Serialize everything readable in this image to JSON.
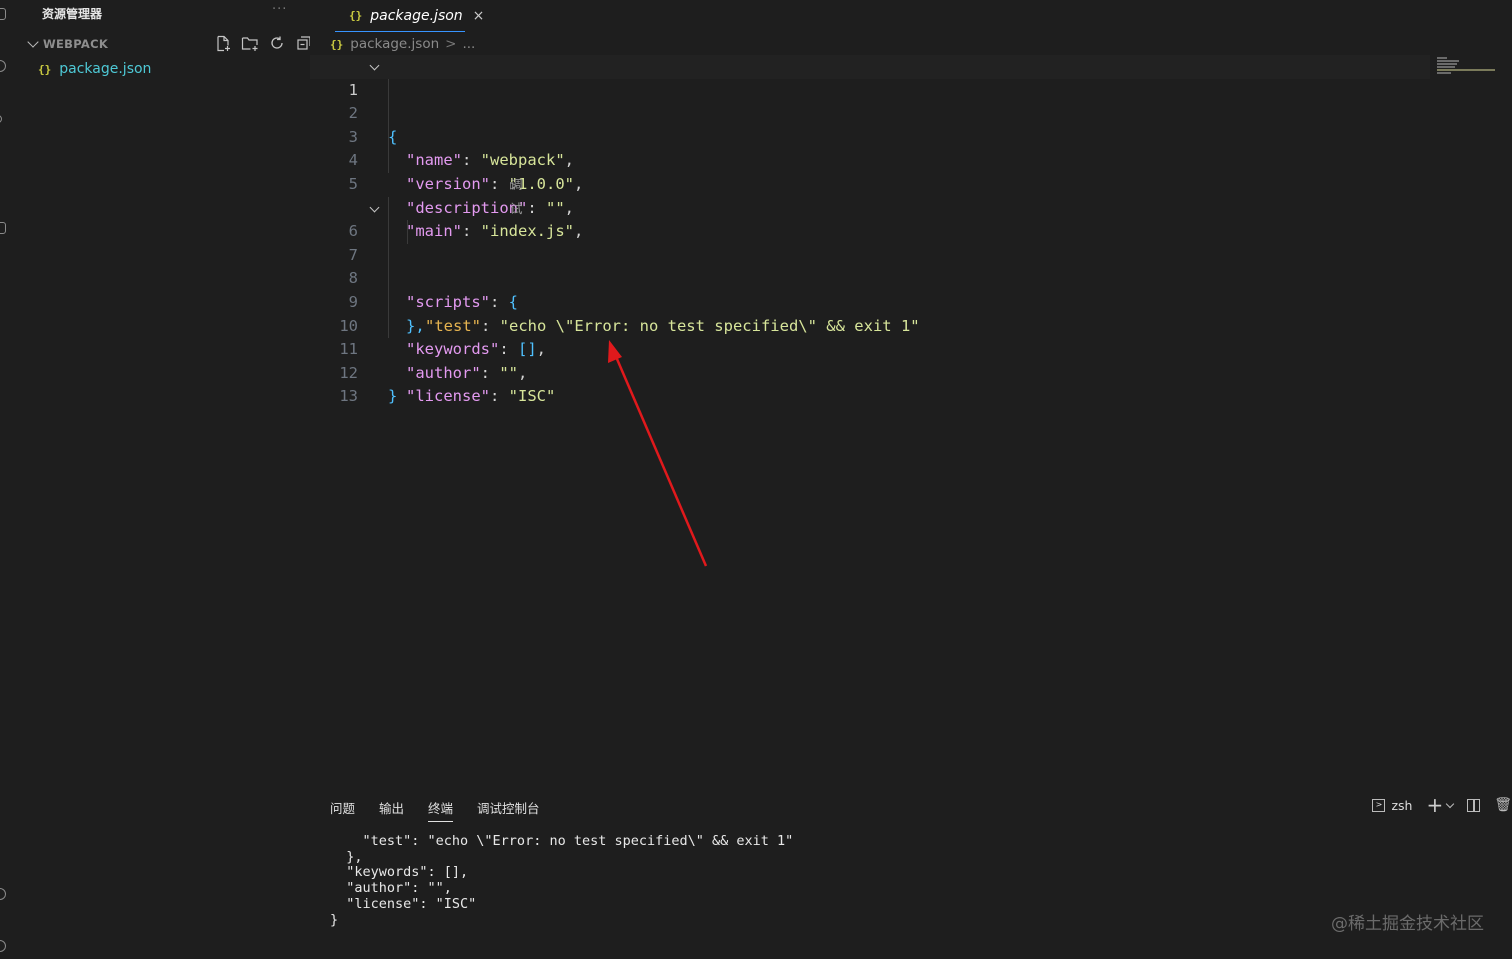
{
  "sidebar": {
    "title": "资源管理器",
    "more": "···",
    "section": "WEBPACK",
    "files": [
      {
        "icon": "{}",
        "name": "package.json"
      }
    ]
  },
  "editor": {
    "tab": {
      "icon": "{}",
      "label": "package.json",
      "close": "×"
    },
    "breadcrumb": {
      "icon": "{}",
      "file": "package.json",
      "sep": ">",
      "rest": "..."
    },
    "codelens": "调试",
    "lines": [
      {
        "num": "1",
        "text": "{"
      },
      {
        "num": "2",
        "key": "\"name\"",
        "colon": ": ",
        "val": "\"webpack\"",
        "end": ","
      },
      {
        "num": "3",
        "key": "\"version\"",
        "colon": ": ",
        "val": "\"1.0.0\"",
        "end": ","
      },
      {
        "num": "4",
        "key": "\"description\"",
        "colon": ": ",
        "val": "\"\"",
        "end": ","
      },
      {
        "num": "5",
        "key": "\"main\"",
        "colon": ": ",
        "val": "\"index.js\"",
        "end": ","
      },
      {
        "num": "6",
        "key": "\"scripts\"",
        "colon": ": ",
        "val": "{",
        "end": ""
      },
      {
        "num": "7",
        "key": "\"test\"",
        "colon": ": ",
        "val": "\"echo \\\"Error: no test specified\\\" && exit 1\"",
        "end": ""
      },
      {
        "num": "8",
        "text": "},"
      },
      {
        "num": "9",
        "key": "\"keywords\"",
        "colon": ": ",
        "val": "[]",
        "end": ","
      },
      {
        "num": "10",
        "key": "\"author\"",
        "colon": ": ",
        "val": "\"\"",
        "end": ","
      },
      {
        "num": "11",
        "key": "\"license\"",
        "colon": ": ",
        "val": "\"ISC\"",
        "end": ""
      },
      {
        "num": "12",
        "text": "}"
      },
      {
        "num": "13",
        "text": ""
      }
    ]
  },
  "panel": {
    "tabs": [
      "问题",
      "输出",
      "终端",
      "调试控制台"
    ],
    "active_tab": "终端",
    "shell": "zsh",
    "terminal_lines": [
      "    \"test\": \"echo \\\"Error: no test specified\\\" && exit 1\"",
      "  },",
      "  \"keywords\": [],",
      "  \"author\": \"\",",
      "  \"license\": \"ISC\"",
      "}"
    ]
  },
  "watermark": "@稀土掘金技术社区",
  "colors": {
    "accent": "#3794ff",
    "annotation_arrow": "#e0191c",
    "json_key": "#e39af0",
    "json_string": "#d7e59a"
  }
}
